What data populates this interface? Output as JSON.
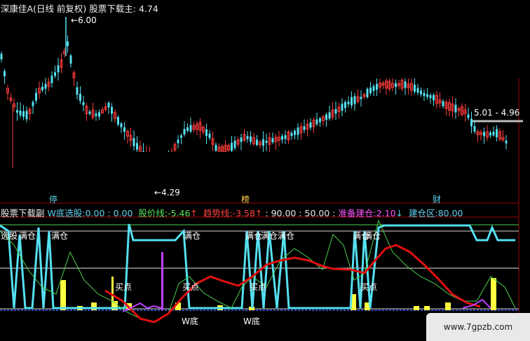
{
  "header": {
    "stock_name": "深康佳A",
    "period": "(日线 前复权)",
    "indicator_name": "股票下载主",
    "indicator_value": ": 4.74"
  },
  "main_chart": {
    "high_label": "6.00",
    "low_label": "4.29",
    "range_label": "5.01 - 4.96",
    "event_markers": [
      "停",
      "榜",
      "财"
    ]
  },
  "sub_header": {
    "name": "股票下载副",
    "items": [
      {
        "label": "W底选股:",
        "value": "0.00 : 0.00",
        "color": "#5fd3f0"
      },
      {
        "label": "股价线:",
        "value": "-5.46",
        "arrow": "↑",
        "color": "#5be45b",
        "arrow_color": "#ff4444"
      },
      {
        "label": "趋势线:",
        "value": "-3.58",
        "arrow": "↑",
        "color": "#ff4444",
        "arrow_color": "#ff4444"
      },
      {
        "label": "",
        "value": ": 90.00 : 50.00 :",
        "color": "#e6e6e6"
      },
      {
        "label": "准备建仓:",
        "value": "2.10",
        "arrow": "↓",
        "color": "#ff55ff",
        "arrow_color": "#5fd3f0"
      },
      {
        "label": "建仓区:",
        "value": "80.00",
        "color": "#5fd3f0"
      }
    ]
  },
  "sub_chart": {
    "chart_labels": [
      {
        "text": "选股",
        "color": "#ffffff"
      },
      {
        "text": "满仓",
        "color": "#ffffff"
      },
      {
        "text": "满仓",
        "color": "#ffffff"
      },
      {
        "text": "满仓",
        "color": "#ffffff"
      },
      {
        "text": "满仓",
        "color": "#ffffff"
      },
      {
        "text": "满仓",
        "color": "#ffffff"
      },
      {
        "text": "满仓",
        "color": "#ffffff"
      },
      {
        "text": "满仓",
        "color": "#ffffff"
      },
      {
        "text": "满仓",
        "color": "#ffffff"
      },
      {
        "text": "买点",
        "color": "#ffffff"
      },
      {
        "text": "买点",
        "color": "#ffffff"
      },
      {
        "text": "买点",
        "color": "#ffffff"
      },
      {
        "text": "买点",
        "color": "#ffffff"
      },
      {
        "text": "W底",
        "color": "#ffffff"
      },
      {
        "text": "W底",
        "color": "#ffffff"
      }
    ]
  },
  "watermark": "www.7gpzb.com",
  "colors": {
    "up": "#ff3c3c",
    "down": "#55e0f0",
    "trend": "#e01010",
    "price_line": "#4ccf4c",
    "magenta": "#c040ff",
    "yellow": "#ffff40",
    "axis_red": "#a00000"
  },
  "chart_data": {
    "type": "candlestick",
    "price_range": [
      4.29,
      6.0
    ],
    "indicator_levels": [
      0,
      50,
      80,
      90
    ],
    "series": [
      {
        "name": "股价线",
        "value": -5.46
      },
      {
        "name": "趋势线",
        "value": -3.58
      },
      {
        "name": "准备建仓",
        "value": 2.1
      },
      {
        "name": "建仓区",
        "value": 80.0
      }
    ]
  }
}
